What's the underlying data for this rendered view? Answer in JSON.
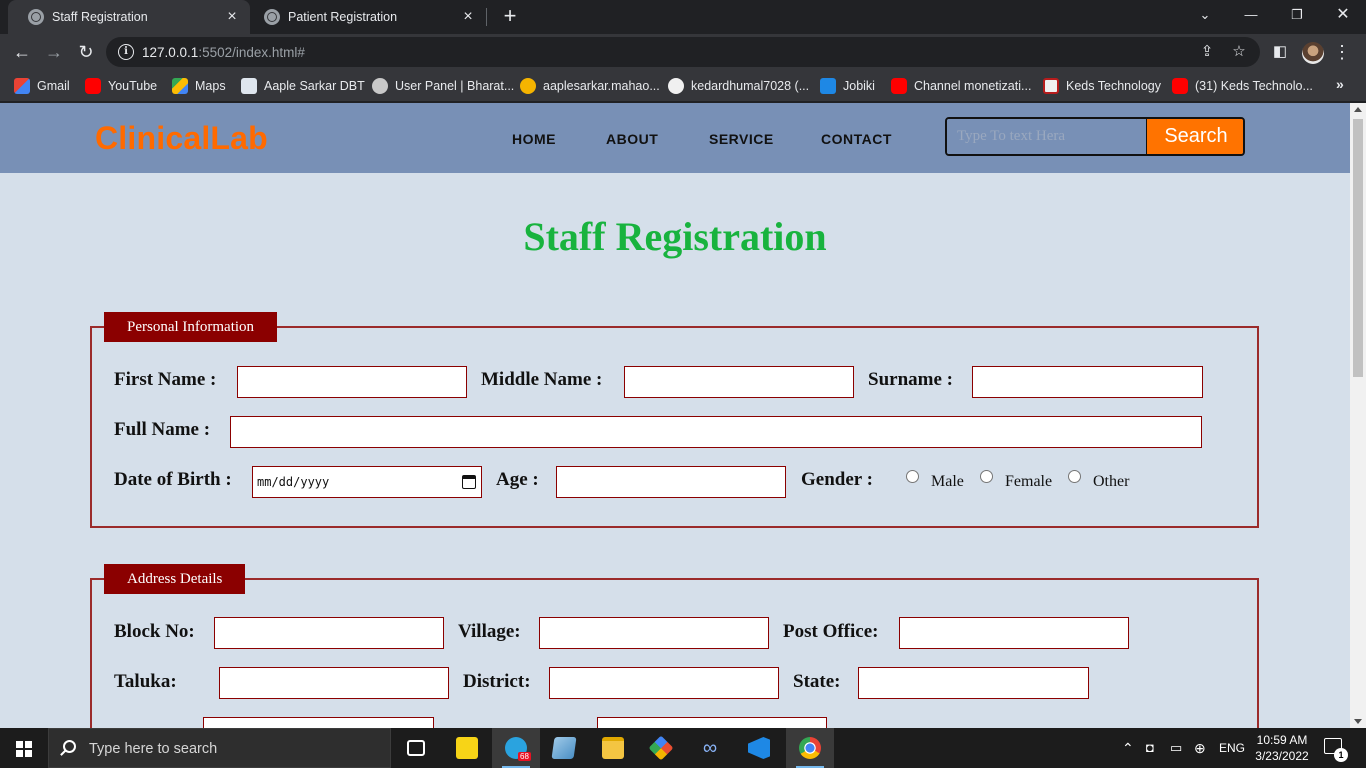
{
  "browser": {
    "tabs": [
      {
        "title": "Staff Registration",
        "active": true
      },
      {
        "title": "Patient Registration",
        "active": false
      }
    ],
    "url_host": "127.0.0.1",
    "url_rest": ":5502/index.html#",
    "bookmarks": [
      {
        "label": "Gmail",
        "icon": "gmail-icon"
      },
      {
        "label": "YouTube",
        "icon": "youtube-icon"
      },
      {
        "label": "Maps",
        "icon": "maps-icon"
      },
      {
        "label": "Aaple Sarkar DBT",
        "icon": "document-icon"
      },
      {
        "label": "User Panel | Bharat...",
        "icon": "emblem-icon"
      },
      {
        "label": "aaplesarkar.mahao...",
        "icon": "sun-icon"
      },
      {
        "label": "kedardhumal7028 (...",
        "icon": "github-icon"
      },
      {
        "label": "Jobiki",
        "icon": "jobiki-icon"
      },
      {
        "label": "Channel monetizati...",
        "icon": "youtube-icon"
      },
      {
        "label": "Keds Technology",
        "icon": "keds-icon"
      },
      {
        "label": "(31) Keds Technolo...",
        "icon": "youtube-icon"
      }
    ],
    "bookmarks_more": "»"
  },
  "site": {
    "logo": "ClinicalLab",
    "nav": [
      "HOME",
      "ABOUT",
      "SERVICE",
      "CONTACT"
    ],
    "search_placeholder": "Type To text Hera",
    "search_button": "Search"
  },
  "form": {
    "title": "Staff Registration",
    "personal": {
      "legend": "Personal Information",
      "first_name_label": "First Name :",
      "middle_name_label": "Middle Name :",
      "surname_label": "Surname :",
      "full_name_label": "Full Name :",
      "dob_label": "Date of Birth :",
      "dob_placeholder": "mm/dd/yyyy",
      "age_label": "Age :",
      "gender_label": "Gender :",
      "gender_options": [
        "Male",
        "Female",
        "Other"
      ]
    },
    "address": {
      "legend": "Address Details",
      "block_label": "Block No:",
      "village_label": "Village:",
      "post_office_label": "Post Office:",
      "taluka_label": "Taluka:",
      "district_label": "District:",
      "state_label": "State:"
    }
  },
  "taskbar": {
    "search_placeholder": "Type here to search",
    "telegram_badge": "68",
    "language": "ENG",
    "time": "10:59 AM",
    "date": "3/23/2022",
    "notifications": "1"
  },
  "colors": {
    "brand_orange": "#ff6a00",
    "title_green": "#18b33e",
    "legend_red": "#8b0000",
    "header_blue": "#7890b6",
    "page_bg": "#d5dfea"
  }
}
